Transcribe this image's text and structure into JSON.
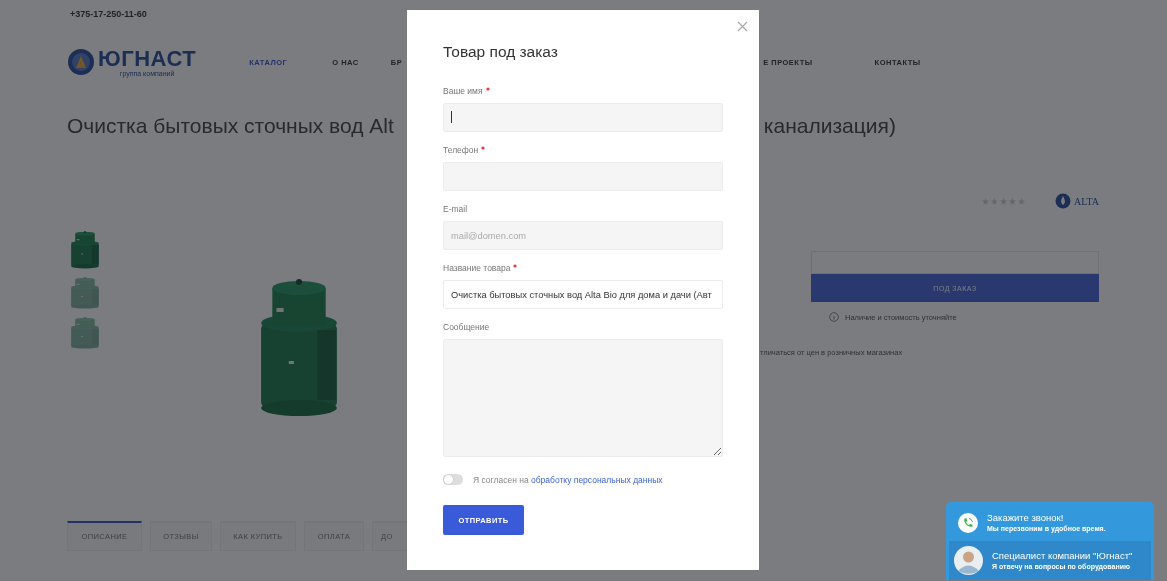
{
  "page": {
    "phone": "+375-17-250-11-60",
    "logo": {
      "name": "ЮГНАСТ",
      "tagline": "группа компаний"
    },
    "nav": [
      {
        "label": "КАТАЛОГ",
        "selected": true
      },
      {
        "label": "О НАС",
        "selected": false
      },
      {
        "label": "БР",
        "selected": false
      },
      {
        "label": "Е ПРОЕКТЫ",
        "selected": false
      },
      {
        "label": "КОНТАКТЫ",
        "selected": false
      }
    ],
    "title_parts": [
      "Очистка бытовых сточных вод Alt",
      "канализация)"
    ],
    "rating": {
      "stars": 0
    },
    "brand": "ALTA",
    "order_button": "ПОД ЗАКАЗ",
    "availability_note": "Наличие и стоимость уточняйте",
    "price_note": "тличаться от цен в розничных магазинах",
    "tabs": [
      {
        "label": "ОПИСАНИЕ",
        "selected": true
      },
      {
        "label": "ОТЗЫВЫ",
        "selected": false
      },
      {
        "label": "КАК КУПИТЬ",
        "selected": false
      },
      {
        "label": "ОПЛАТА",
        "selected": false
      },
      {
        "label": "ДО",
        "selected": false
      }
    ]
  },
  "modal": {
    "title": "Товар под заказ",
    "fields": [
      {
        "kind": "input",
        "label": "Ваше имя",
        "required": true,
        "focused": true
      },
      {
        "kind": "input",
        "label": "Телефон",
        "required": true,
        "focused": false
      },
      {
        "kind": "input",
        "label": "E-mail",
        "required": false,
        "focused": false,
        "placeholder": "mail@domen.com"
      },
      {
        "kind": "input",
        "label": "Название товара",
        "required": true,
        "focused": false,
        "value": "Очистка бытовых сточных вод Alta Bio для дома и дачи (Авт"
      },
      {
        "kind": "textarea",
        "label": "Сообщение",
        "required": false,
        "focused": false
      }
    ],
    "consent": {
      "on": false,
      "text": "Я согласен на",
      "link": "обработку персональных данных"
    },
    "submit": "ОТПРАВИТЬ"
  },
  "callback_widget": {
    "items": [
      {
        "kind": "call",
        "title": "Закажите звонок!",
        "subtitle": "Мы перезвоним в удобное время."
      },
      {
        "kind": "specialist",
        "title": "Специалист компании \"Югнаст\"",
        "subtitle": "Я отвечу на вопросы по оборудованию"
      }
    ]
  }
}
